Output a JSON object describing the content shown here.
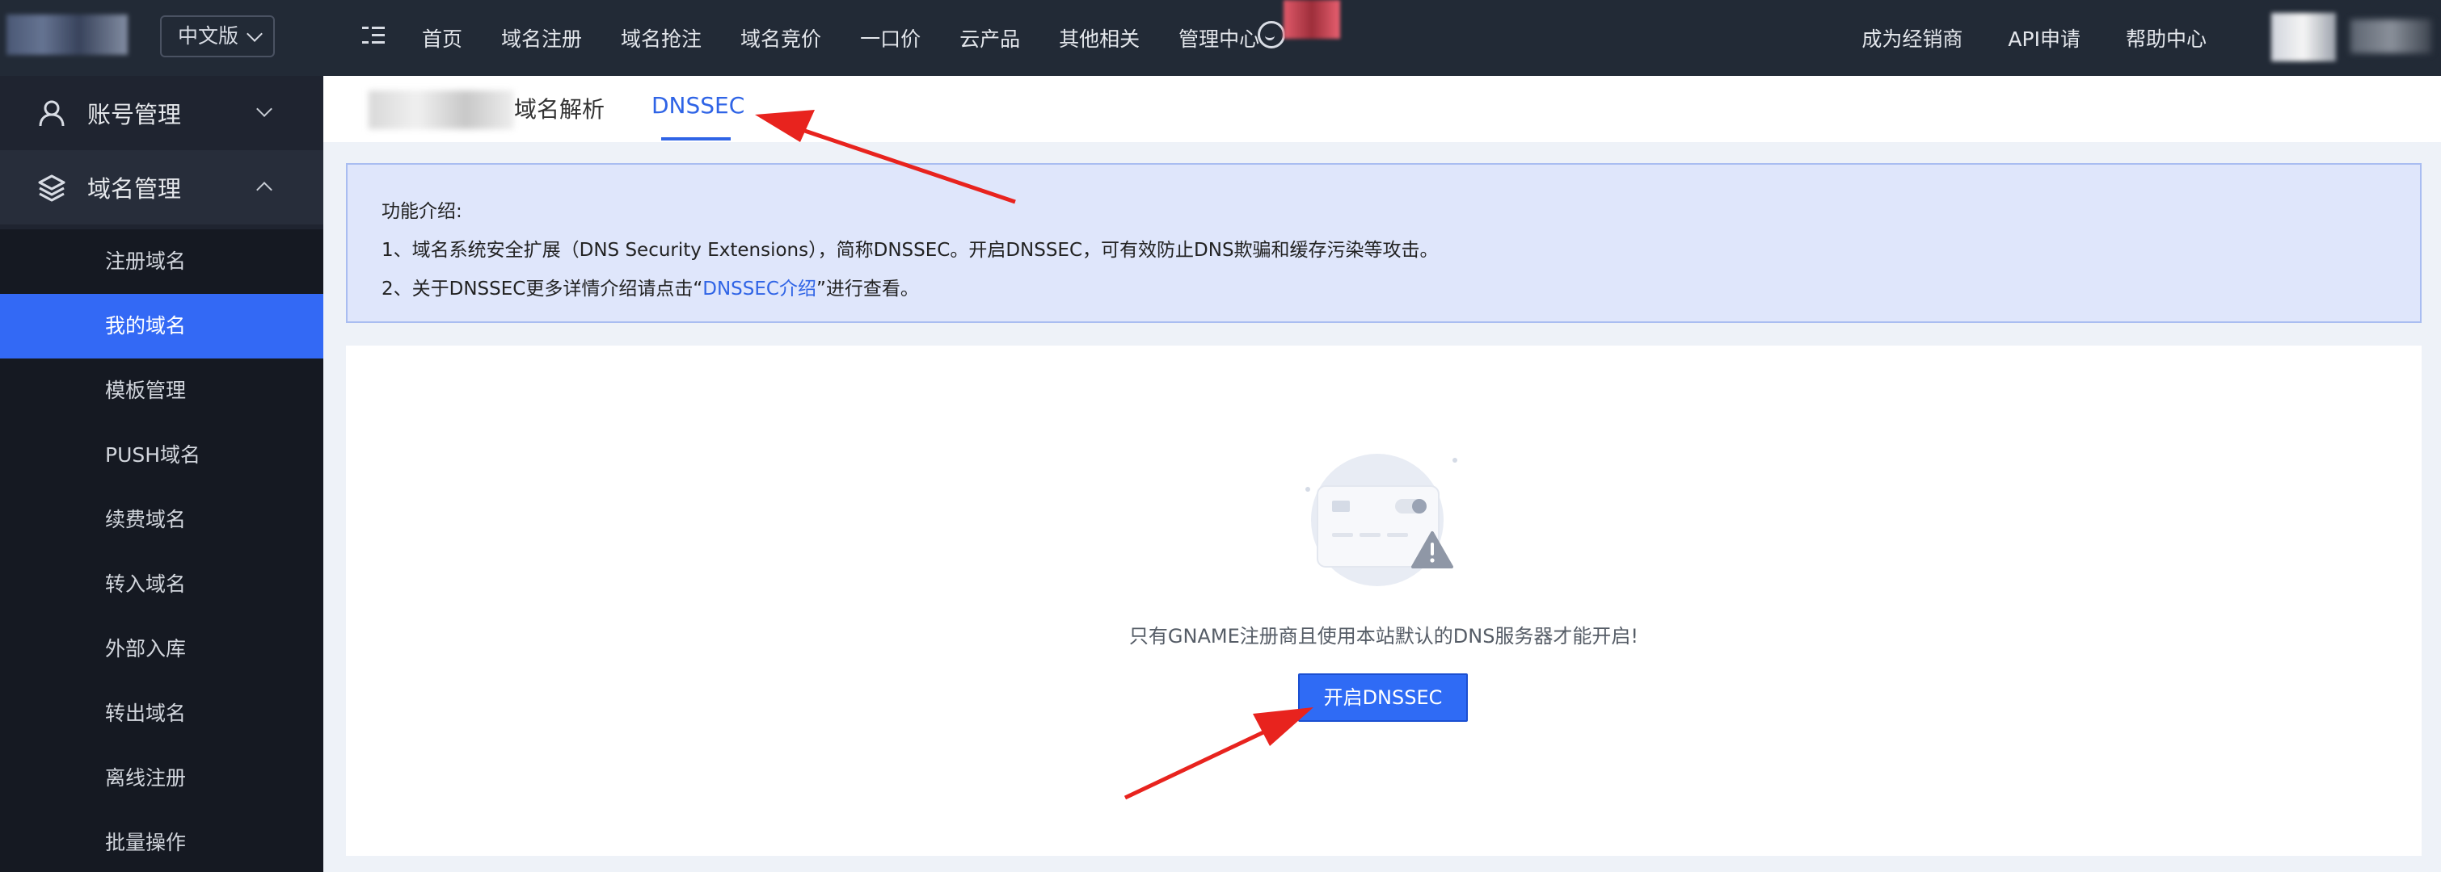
{
  "header": {
    "language": "中文版",
    "nav": [
      "首页",
      "域名注册",
      "域名抢注",
      "域名竞价",
      "一口价",
      "云产品",
      "其他相关",
      "管理中心"
    ],
    "right_nav": [
      "成为经销商",
      "API申请",
      "帮助中心"
    ]
  },
  "sidebar": {
    "groups": [
      {
        "label": "账号管理",
        "icon": "user-icon"
      },
      {
        "label": "域名管理",
        "icon": "layers-icon"
      }
    ],
    "items": [
      "注册域名",
      "我的域名",
      "模板管理",
      "PUSH域名",
      "续费域名",
      "转入域名",
      "外部入库",
      "转出域名",
      "离线注册",
      "批量操作"
    ],
    "active_item": "我的域名"
  },
  "tabs": {
    "tab1": "域名解析",
    "tab2": "DNSSEC"
  },
  "info": {
    "title": "功能介绍:",
    "line1": "1、域名系统安全扩展（DNS Security Extensions），简称DNSSEC。开启DNSSEC，可有效防止DNS欺骗和缓存污染等攻击。",
    "line2_prefix": "2、关于DNSSEC更多详情介绍请点击“",
    "line2_link": "DNSSEC介绍",
    "line2_suffix": "”进行查看。"
  },
  "empty_state": {
    "message": "只有GNAME注册商且使用本站默认的DNS服务器才能开启!",
    "button": "开启DNSSEC"
  },
  "colors": {
    "topbar": "#222a36",
    "sidebar": "#1f2430",
    "accent": "#3369f5",
    "annotation_arrow": "#e8231e"
  }
}
